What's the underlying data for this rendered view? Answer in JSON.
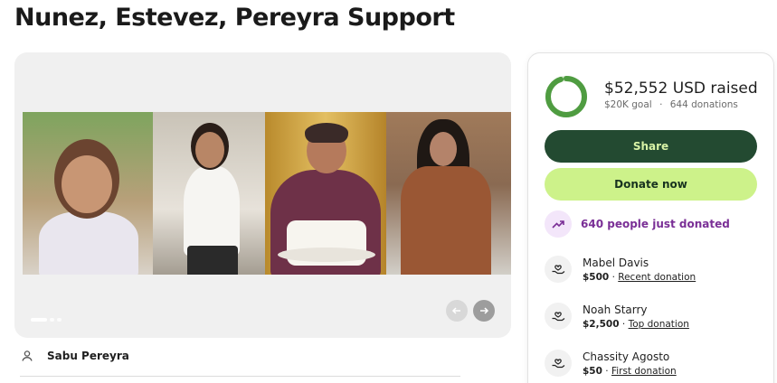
{
  "campaign": {
    "title": "Nunez, Estevez, Pereyra Support"
  },
  "gallery": {
    "prev_icon": "arrow-left-icon",
    "next_icon": "arrow-right-icon",
    "slide_count": 3,
    "active_slide": 1
  },
  "organizer": {
    "icon": "person-icon",
    "name": "Sabu Pereyra"
  },
  "donation_panel": {
    "raised": "$52,552 USD raised",
    "goal": "$20K goal",
    "separator": "·",
    "donations": "644 donations",
    "progress_fraction": 0.95,
    "share_label": "Share",
    "donate_label": "Donate now",
    "recent_activity": "640 people just donated",
    "donors": [
      {
        "name": "Mabel Davis",
        "amount": "$500",
        "separator": "·",
        "label": "Recent donation"
      },
      {
        "name": "Noah Starry",
        "amount": "$2,500",
        "separator": "·",
        "label": "Top donation"
      },
      {
        "name": "Chassity Agosto",
        "amount": "$50",
        "separator": "·",
        "label": "First donation"
      }
    ]
  },
  "colors": {
    "share_button": "#234a31",
    "share_text": "#d8f2a6",
    "donate_button": "#cdf28a",
    "donate_text": "#18331f",
    "progress_ring": "#4f9c41",
    "accent_purple": "#7a2f96"
  }
}
